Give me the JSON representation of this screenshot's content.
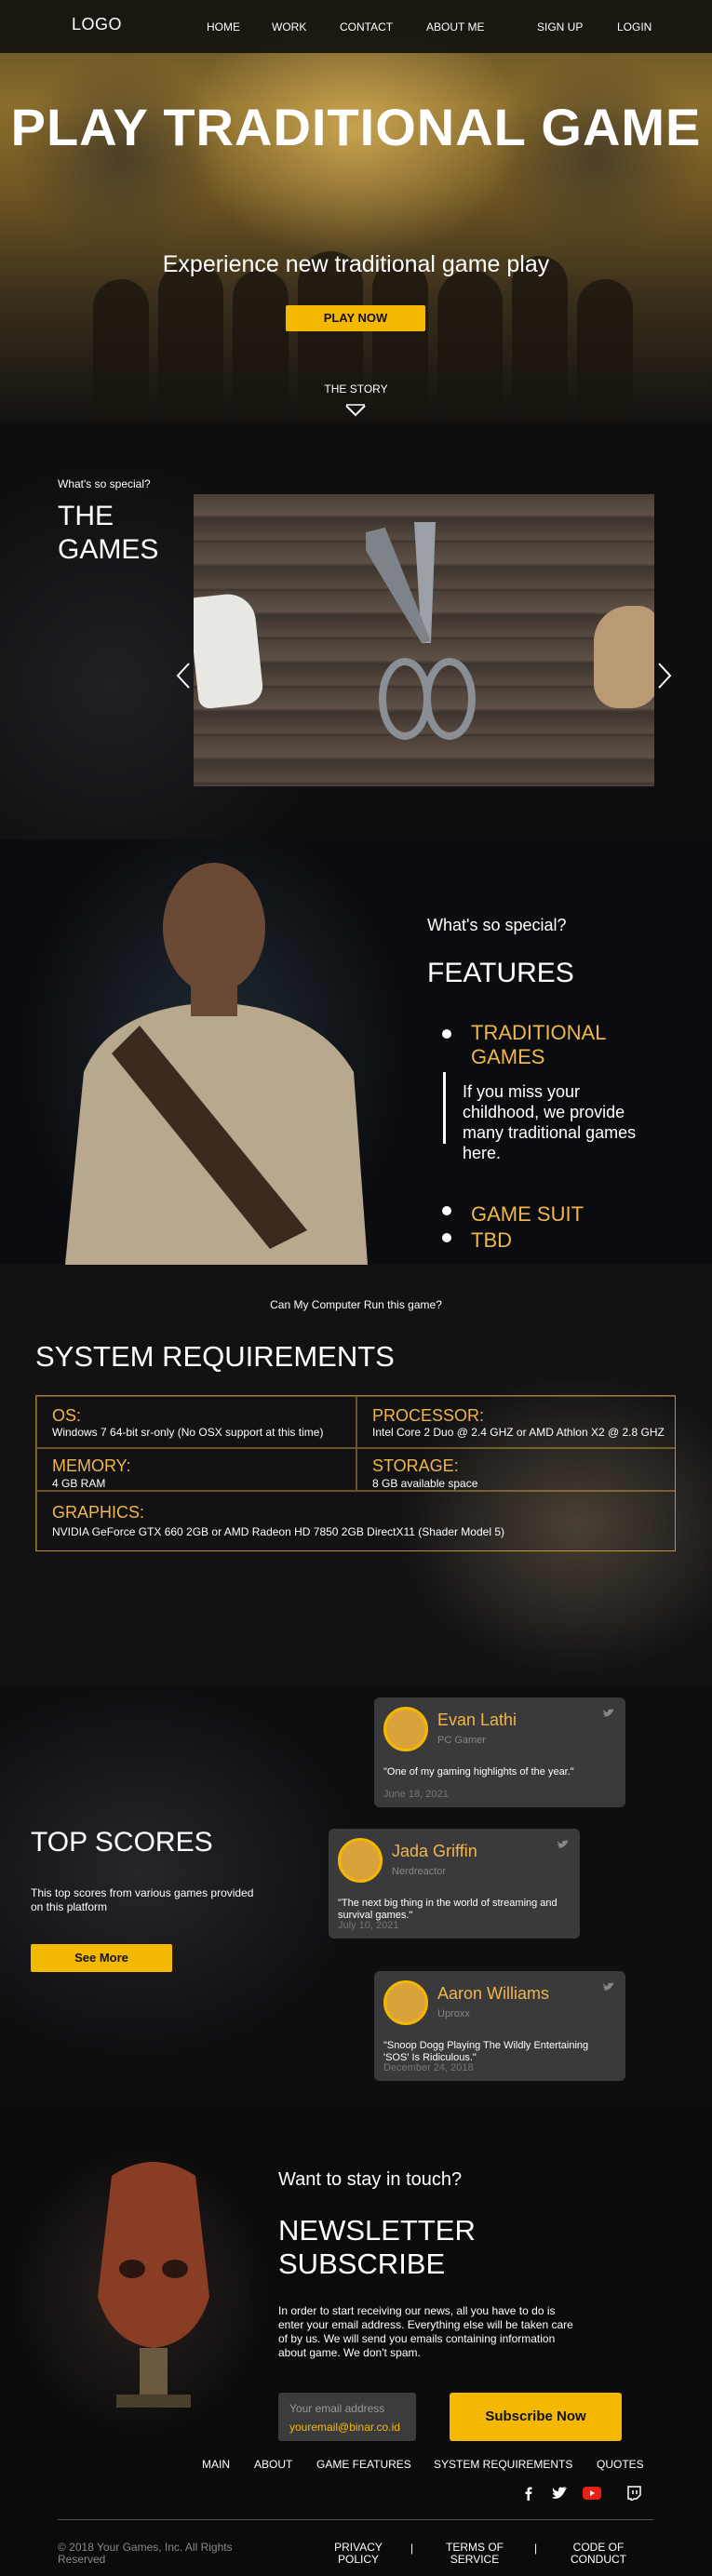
{
  "nav": {
    "logo": "LOGO",
    "links": [
      "HOME",
      "WORK",
      "CONTACT",
      "ABOUT ME"
    ],
    "signup": "SIGN UP",
    "login": "LOGIN"
  },
  "hero": {
    "title": "PLAY TRADITIONAL GAME",
    "subtitle": "Experience new traditional game play",
    "cta": "PLAY NOW",
    "story": "THE STORY"
  },
  "games": {
    "kicker": "What's so special?",
    "heading_line1": "THE",
    "heading_line2": "GAMES",
    "slide_count": 5,
    "active_slide": 1
  },
  "features": {
    "kicker": "What's so special?",
    "heading": "FEATURES",
    "item1": "TRADITIONAL GAMES",
    "quote": "If you miss your childhood, we provide many traditional games here.",
    "item2": "GAME SUIT",
    "item3": "TBD"
  },
  "sysreq": {
    "ask": "Can My Computer Run this game?",
    "heading": "SYSTEM REQUIREMENTS",
    "os_label": "OS:",
    "os_value": "Windows 7 64-bit sr-only (No OSX support at this time)",
    "processor_label": "PROCESSOR:",
    "processor_value": "Intel Core 2 Duo @ 2.4 GHZ or AMD Athlon X2 @ 2.8 GHZ",
    "memory_label": "MEMORY:",
    "memory_value": "4 GB RAM",
    "storage_label": "STORAGE:",
    "storage_value": "8 GB available space",
    "graphics_label": "GRAPHICS:",
    "graphics_value": "NVIDIA GeForce GTX 660 2GB or AMD Radeon HD 7850 2GB DirectX11 (Shader Model 5)"
  },
  "scores": {
    "heading": "TOP SCORES",
    "desc": "This top scores from various games provided on this platform",
    "cta": "See More",
    "cards": [
      {
        "name": "Evan Lathi",
        "source": "PC Gamer",
        "text": "\"One of my gaming highlights of the year.\"",
        "date": "June 18, 2021"
      },
      {
        "name": "Jada Griffin",
        "source": "Nerdreactor",
        "text": "\"The next big thing in the world of streaming and survival games.\"",
        "date": "July 10, 2021"
      },
      {
        "name": "Aaron Williams",
        "source": "Uproxx",
        "text": "\"Snoop Dogg Playing The Wildly Entertaining 'SOS' Is Ridiculous.\"",
        "date": "December 24, 2018"
      }
    ]
  },
  "newsletter": {
    "kicker": "Want to stay in touch?",
    "heading_line1": "NEWSLETTER",
    "heading_line2": "SUBSCRIBE",
    "desc": "In order to start receiving our news, all you have to do is enter your email address. Everything else will be taken care of by us. We will send you emails containing information about game. We don't spam.",
    "email_placeholder": "Your email address",
    "email_value": "youremail@binar.co.id",
    "subscribe": "Subscribe Now"
  },
  "footer": {
    "links": [
      "MAIN",
      "ABOUT",
      "GAME FEATURES",
      "SYSTEM REQUIREMENTS",
      "QUOTES"
    ],
    "copyright": "© 2018 Your Games, Inc. All Rights Reserved",
    "privacy_line1": "PRIVACY",
    "privacy_line2": "POLICY",
    "terms_line1": "TERMS OF",
    "terms_line2": "SERVICE",
    "code_line1": "CODE OF",
    "code_line2": "CONDUCT",
    "separator": "|",
    "social": [
      "facebook-icon",
      "twitter-icon",
      "youtube-icon",
      "twitch-icon"
    ]
  },
  "colors": {
    "accent": "#f5b800",
    "gold_text": "#f0b64a",
    "youtube_red": "#e62117"
  }
}
